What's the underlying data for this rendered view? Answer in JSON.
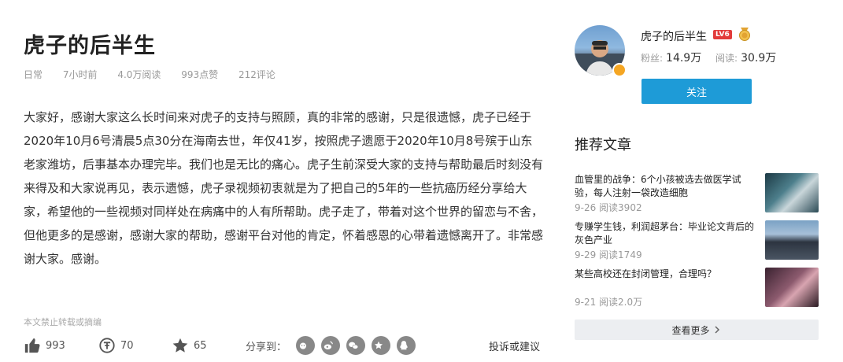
{
  "article": {
    "title": "虎子的后半生",
    "meta": {
      "category": "日常",
      "time": "7小时前",
      "reads": "4.0万阅读",
      "likes": "993点赞",
      "comments": "212评论"
    },
    "content": "大家好，感谢大家这么长时间来对虎子的支持与照顾，真的非常的感谢，只是很遗憾，虎子已经于2020年10月6号清晨5点30分在海南去世，年仅41岁，按照虎子遗愿于2020年10月8号殡于山东老家潍坊，后事基本办理完毕。我们也是无比的痛心。虎子生前深受大家的支持与帮助最后时刻没有来得及和大家说再见，表示遗憾，虎子录视频初衷就是为了把自己的5年的一些抗癌历经分享给大家，希望他的一些视频对同样处在病痛中的人有所帮助。虎子走了，带着对这个世界的留恋与不舍，但他更多的是感谢，感谢大家的帮助，感谢平台对他的肯定，怀着感恩的心带着遗憾离开了。非常感谢大家。感谢。",
    "copyright": "本文禁止转载或摘编",
    "actions": {
      "like_count": "993",
      "coin_count": "70",
      "favorite_count": "65",
      "share_label": "分享到：",
      "report_label": "投诉或建议"
    }
  },
  "author": {
    "name": "虎子的后半生",
    "level": "LV6",
    "fans_label": "粉丝:",
    "fans": "14.9万",
    "reads_label": "阅读:",
    "reads": "30.9万",
    "follow_label": "关注"
  },
  "recommend": {
    "title": "推荐文章",
    "items": [
      {
        "title": "血管里的战争：6个小孩被选去做医学试验，每人注射一袋改造细胞",
        "meta": "9-26 阅读3902"
      },
      {
        "title": "专赚学生钱，利润超茅台：毕业论文背后的灰色产业",
        "meta": "9-29 阅读1749"
      },
      {
        "title": "某些高校还在封闭管理，合理吗？",
        "meta": "9-21 阅读2.0万"
      }
    ],
    "more_label": "查看更多"
  }
}
